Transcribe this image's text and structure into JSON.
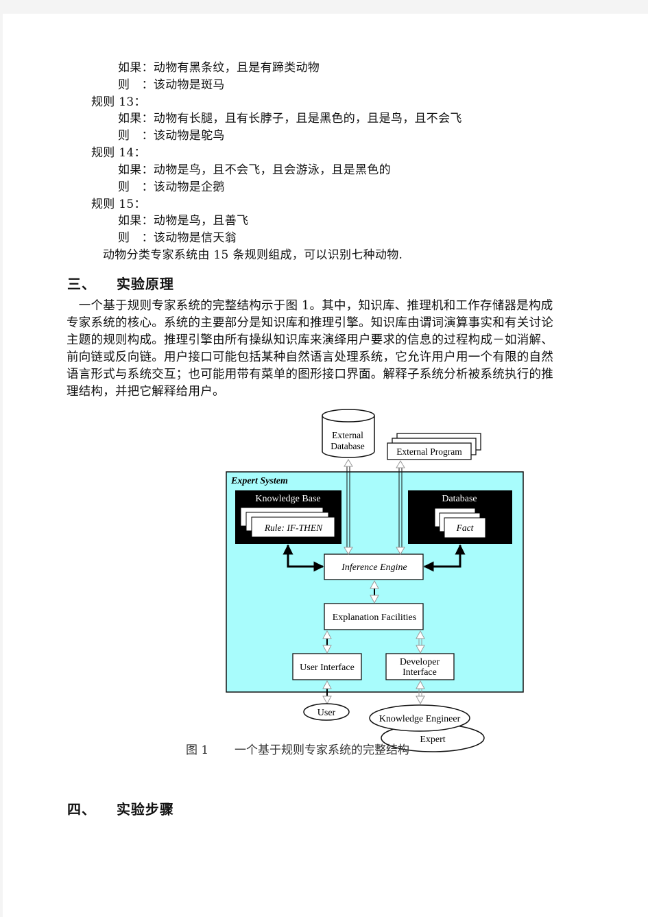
{
  "rules_continued": {
    "rule12_if": "如果：动物有黑条纹，且是有蹄类动物",
    "rule12_then": "则　：该动物是斑马"
  },
  "rules": [
    {
      "title": "规则 13：",
      "if": "如果：动物有长腿，且有长脖子，且是黑色的，且是鸟，且不会飞",
      "then": "则　：该动物是鸵鸟"
    },
    {
      "title": "规则 14：",
      "if": "如果：动物是鸟，且不会飞，且会游泳，且是黑色的",
      "then": "则　：该动物是企鹅"
    },
    {
      "title": "规则 15：",
      "if": "如果：动物是鸟，且善飞",
      "then": "则　：该动物是信天翁"
    }
  ],
  "summary": "动物分类专家系统由 15 条规则组成，可以识别七种动物.",
  "section3": {
    "number": "三、",
    "title": "实验原理",
    "paragraph_lines": [
      "　一个基于规则专家系统的完整结构示于图 1。其中，知识库、推理机和工作存储器是构成",
      "专家系统的核心。系统的主要部分是知识库和推理引擎。知识库由谓词演算事实和有关讨论",
      "主题的规则构成。推理引擎由所有操纵知识库来演绎用户要求的信息的过程构成－如消解、",
      "前向链或反向链。用户接口可能包括某种自然语言处理系统，它允许用户用一个有限的自然",
      "语言形式与系统交互；也可能用带有菜单的图形接口界面。解释子系统分析被系统执行的推",
      "理结构，并把它解释给用户。"
    ]
  },
  "figure": {
    "external_database": [
      "External",
      "Database"
    ],
    "external_program": "External  Program",
    "expert_system": "Expert  System",
    "knowledge_base": "Knowledge  Base",
    "rule": "Rule:  IF-THEN",
    "database": "Database",
    "fact": "Fact",
    "inference_engine": "Inference  Engine",
    "explanation_facilities": "Explanation  Facilities",
    "user_interface": "User  Interface",
    "developer_interface": [
      "Developer",
      "Interface"
    ],
    "user": "User",
    "knowledge_engineer": "Knowledge  Engineer",
    "expert": "Expert",
    "colors": {
      "system_bg": "#a8fcfc",
      "dark_box": "#000000"
    },
    "caption_number": "图 1",
    "caption_text": "一个基于规则专家系统的完整结构"
  },
  "section4": {
    "number": "四、",
    "title": "实验步骤"
  }
}
